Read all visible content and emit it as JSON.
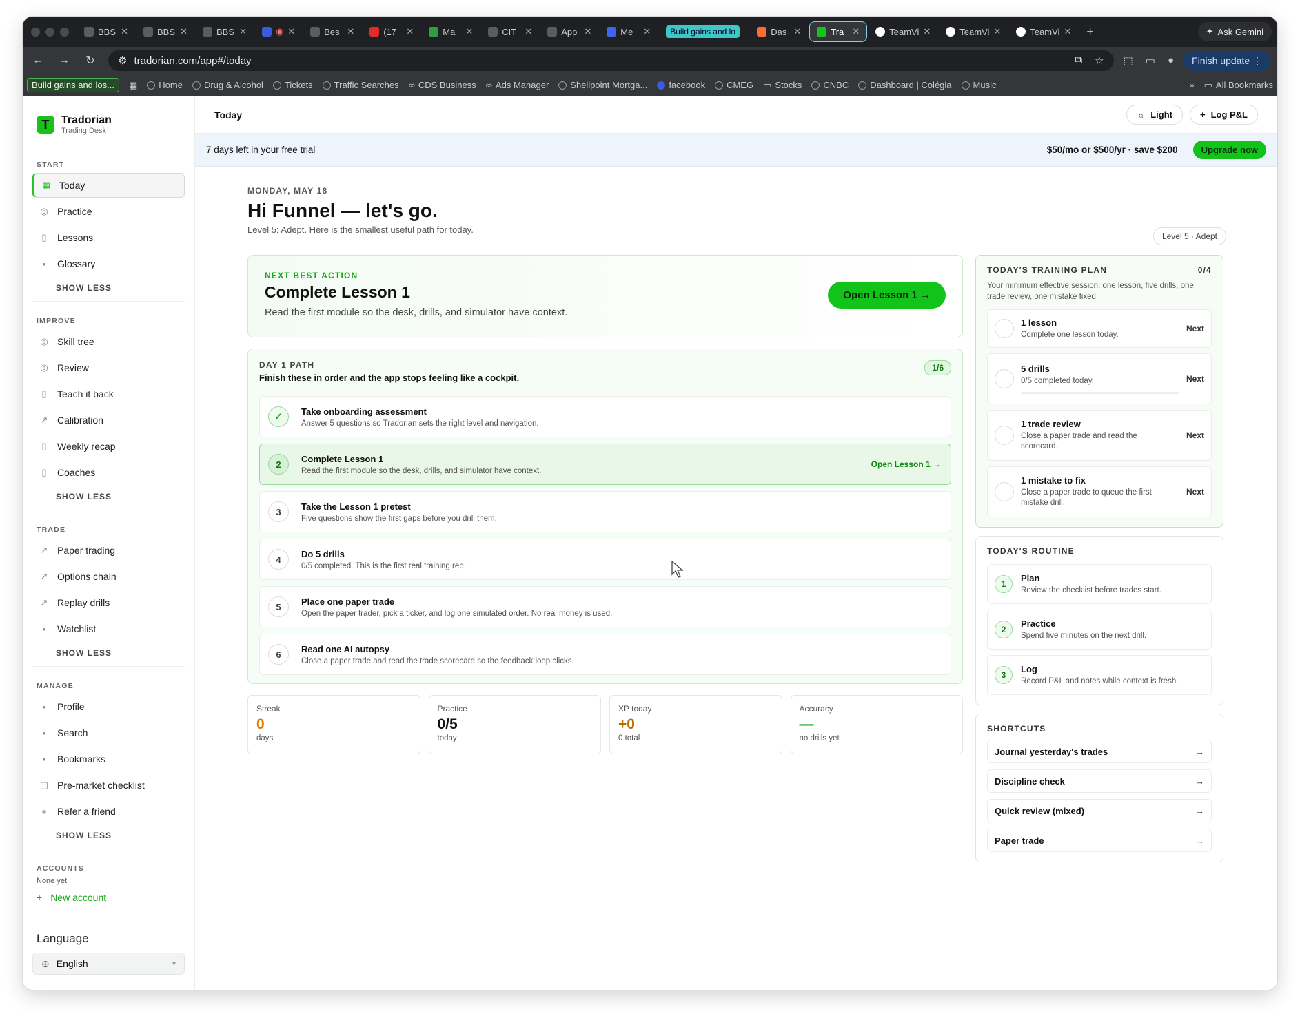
{
  "browser": {
    "tabs": [
      {
        "label": "BBS"
      },
      {
        "label": "BBS"
      },
      {
        "label": "BBS"
      },
      {
        "label": ""
      },
      {
        "label": "Bes"
      },
      {
        "label": "(17"
      },
      {
        "label": "Ma"
      },
      {
        "label": "CIT"
      },
      {
        "label": "App"
      },
      {
        "label": "Me"
      },
      {
        "label": "Build gains and lo"
      },
      {
        "label": "Das"
      },
      {
        "label": "Tra"
      },
      {
        "label": "TeamVi"
      },
      {
        "label": "TeamVi"
      },
      {
        "label": "TeamVi"
      }
    ],
    "ask_gemini": "Ask Gemini",
    "url": "tradorian.com/app#/today",
    "finish_update": "Finish update",
    "bookmarks": [
      "Home",
      "Drug & Alcohol",
      "Tickets",
      "Traffic Searches",
      "CDS Business",
      "Ads Manager",
      "Shellpoint Mortga...",
      "facebook",
      "CMEG",
      "Stocks",
      "CNBC",
      "Dashboard | Colégia",
      "Music"
    ],
    "bookmark_group": "Build gains and los...",
    "all_bookmarks": "All Bookmarks"
  },
  "sidebar": {
    "brand": "Tradorian",
    "brand_sub": "Trading Desk",
    "sections": [
      {
        "title": "START",
        "items": [
          "Today",
          "Practice",
          "Lessons",
          "Glossary"
        ],
        "show_less": "SHOW LESS"
      },
      {
        "title": "IMPROVE",
        "items": [
          "Skill tree",
          "Review",
          "Teach it back",
          "Calibration",
          "Weekly recap",
          "Coaches"
        ],
        "show_less": "SHOW LESS"
      },
      {
        "title": "TRADE",
        "items": [
          "Paper trading",
          "Options chain",
          "Replay drills",
          "Watchlist"
        ],
        "show_less": "SHOW LESS"
      },
      {
        "title": "MANAGE",
        "items": [
          "Profile",
          "Search",
          "Bookmarks",
          "Pre-market checklist",
          "Refer a friend"
        ],
        "show_less": "SHOW LESS"
      }
    ],
    "accounts_title": "ACCOUNTS",
    "accounts_none": "None yet",
    "new_account": "New account",
    "language_title": "Language",
    "language_value": "English"
  },
  "topbar": {
    "title": "Today",
    "theme": "Light",
    "log_pnl": "Log P&L"
  },
  "trial": {
    "text": "7 days left in your free trial",
    "price": "$50/mo or $500/yr · save $200",
    "upgrade": "Upgrade now"
  },
  "hero": {
    "date": "MONDAY, MAY 18",
    "greeting": "Hi Funnel — let's go.",
    "subtitle": "Level 5: Adept. Here is the smallest useful path for today.",
    "level_pill": "Level 5 · Adept"
  },
  "next_best": {
    "label": "NEXT BEST ACTION",
    "title": "Complete Lesson 1",
    "desc": "Read the first module so the desk, drills, and simulator have context.",
    "button": "Open Lesson 1 →"
  },
  "day_path": {
    "label": "DAY 1 PATH",
    "subtitle": "Finish these in order and the app stops feeling like a cockpit.",
    "count": "1/6",
    "steps": [
      {
        "num": "✓",
        "title": "Take onboarding assessment",
        "desc": "Answer 5 questions so Tradorian sets the right level and navigation.",
        "link": ""
      },
      {
        "num": "2",
        "title": "Complete Lesson 1",
        "desc": "Read the first module so the desk, drills, and simulator have context.",
        "link": "Open Lesson 1 →"
      },
      {
        "num": "3",
        "title": "Take the Lesson 1 pretest",
        "desc": "Five questions show the first gaps before you drill them.",
        "link": ""
      },
      {
        "num": "4",
        "title": "Do 5 drills",
        "desc": "0/5 completed. This is the first real training rep.",
        "link": ""
      },
      {
        "num": "5",
        "title": "Place one paper trade",
        "desc": "Open the paper trader, pick a ticker, and log one simulated order. No real money is used.",
        "link": ""
      },
      {
        "num": "6",
        "title": "Read one AI autopsy",
        "desc": "Close a paper trade and read the trade scorecard so the feedback loop clicks.",
        "link": ""
      }
    ]
  },
  "stats": [
    {
      "label": "Streak",
      "value": "0",
      "sub": "days",
      "color": "#e07b00"
    },
    {
      "label": "Practice",
      "value": "0/5",
      "sub": "today",
      "color": "#111111"
    },
    {
      "label": "XP today",
      "value": "+0",
      "sub": "0 total",
      "color": "#b86a00"
    },
    {
      "label": "Accuracy",
      "value": "—",
      "sub": "no drills yet",
      "color": "#15a515"
    }
  ],
  "training_plan": {
    "title": "TODAY'S TRAINING PLAN",
    "count": "0/4",
    "desc": "Your minimum effective session: one lesson, five drills, one trade review, one mistake fixed.",
    "items": [
      {
        "title": "1 lesson",
        "desc": "Complete one lesson today.",
        "action": "Next"
      },
      {
        "title": "5 drills",
        "desc": "0/5 completed today.",
        "action": "Next",
        "progress": 0
      },
      {
        "title": "1 trade review",
        "desc": "Close a paper trade and read the scorecard.",
        "action": "Next"
      },
      {
        "title": "1 mistake to fix",
        "desc": "Close a paper trade to queue the first mistake drill.",
        "action": "Next"
      }
    ]
  },
  "routine": {
    "title": "TODAY'S ROUTINE",
    "items": [
      {
        "num": "1",
        "title": "Plan",
        "desc": "Review the checklist before trades start."
      },
      {
        "num": "2",
        "title": "Practice",
        "desc": "Spend five minutes on the next drill."
      },
      {
        "num": "3",
        "title": "Log",
        "desc": "Record P&L and notes while context is fresh."
      }
    ]
  },
  "shortcuts": {
    "title": "SHORTCUTS",
    "items": [
      "Journal yesterday's trades",
      "Discipline check",
      "Quick review (mixed)",
      "Paper trade"
    ]
  },
  "colors": {
    "accent": "#12c41a",
    "trial_bg": "#eef4fb"
  }
}
